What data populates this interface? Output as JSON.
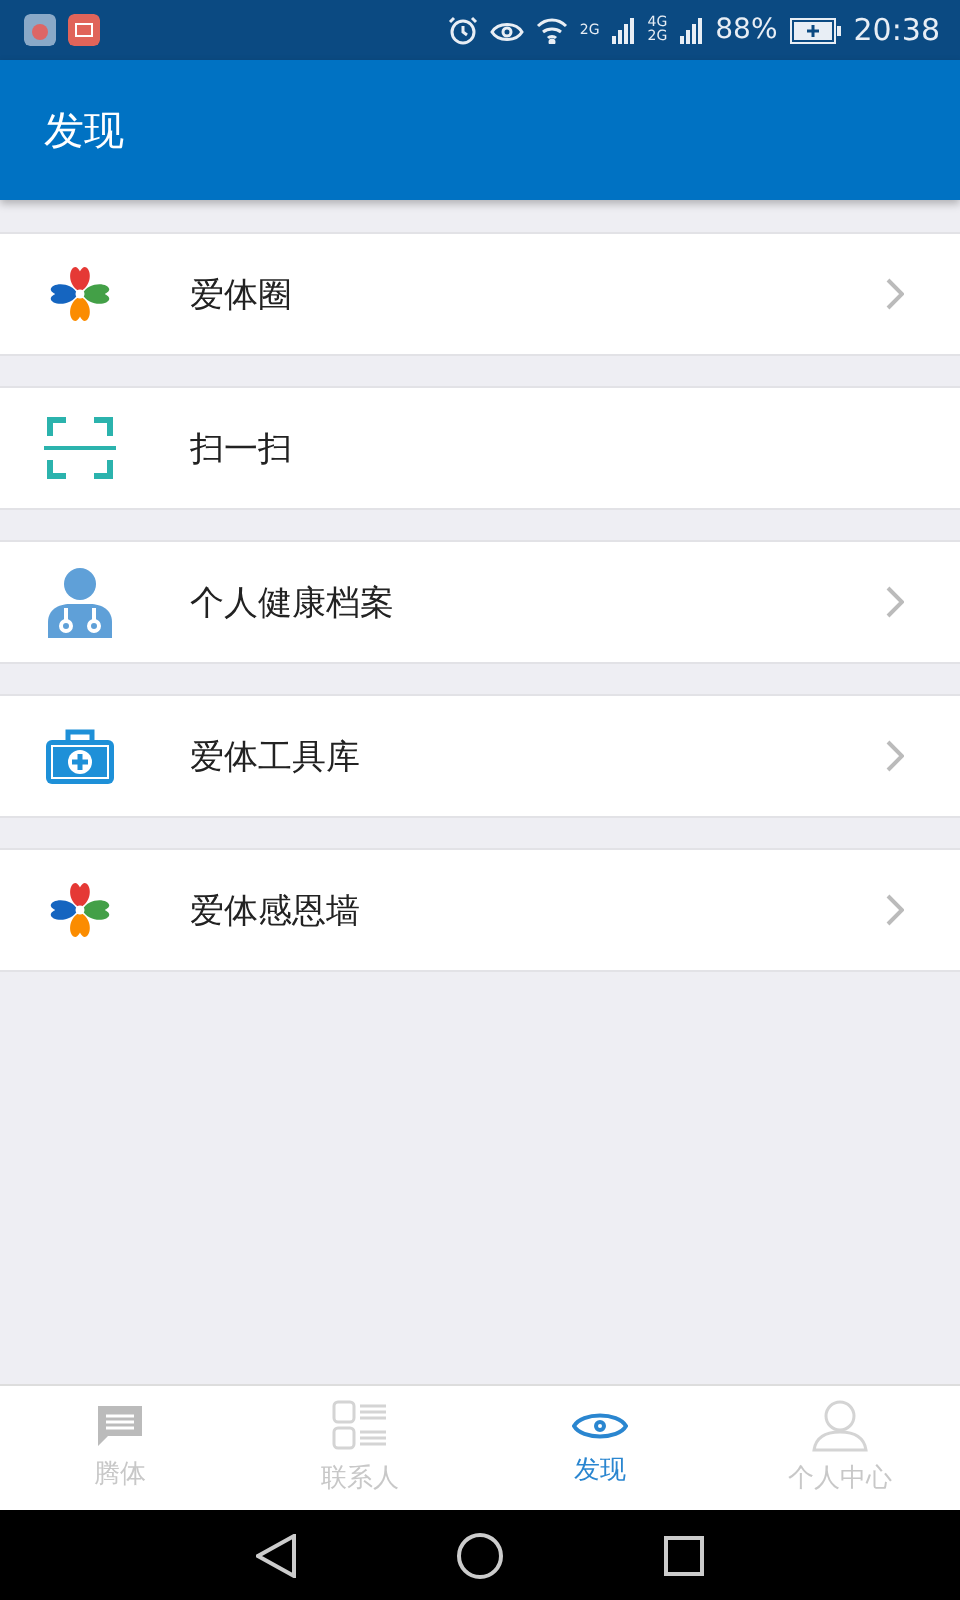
{
  "status_bar": {
    "sim1_label": "2G",
    "sim2_labels": [
      "4G",
      "2G"
    ],
    "battery": "88%",
    "time": "20:38"
  },
  "header": {
    "title": "发现"
  },
  "items": [
    {
      "label": "爱体圈",
      "kind": "clover",
      "has_arrow": true
    },
    {
      "label": "扫一扫",
      "kind": "scan",
      "has_arrow": false
    },
    {
      "label": "个人健康档案",
      "kind": "doctor",
      "has_arrow": true
    },
    {
      "label": "爱体工具库",
      "kind": "toolbox",
      "has_arrow": true
    },
    {
      "label": "爱体感恩墙",
      "kind": "clover",
      "has_arrow": true
    }
  ],
  "tabs": [
    {
      "label": "腾体",
      "kind": "chat",
      "selected": false
    },
    {
      "label": "联系人",
      "kind": "contacts",
      "selected": false
    },
    {
      "label": "发现",
      "kind": "eye",
      "selected": true
    },
    {
      "label": "个人中心",
      "kind": "person",
      "selected": false
    }
  ]
}
